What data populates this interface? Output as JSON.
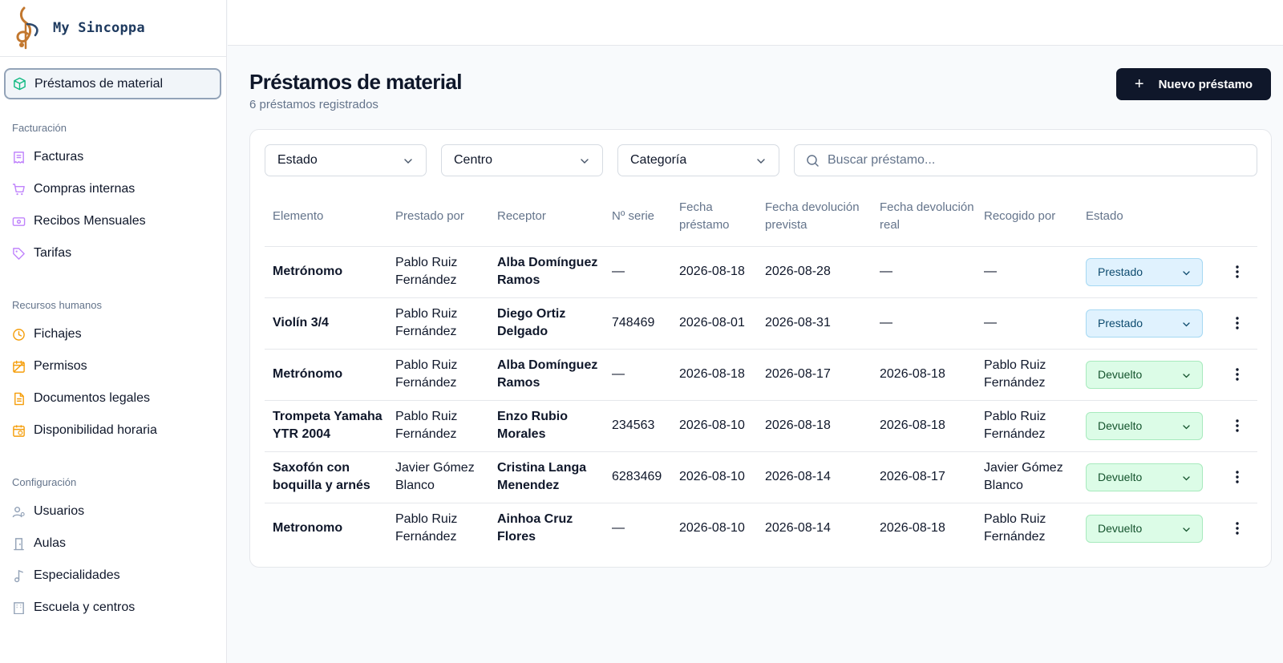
{
  "app": {
    "name": "My Sincoppa"
  },
  "colors": {
    "primary": "#0f172a",
    "prestado_bg": "#e0f2fe",
    "devuelto_bg": "#dcfce7",
    "muted": "#64748b"
  },
  "sidebar": {
    "active": {
      "label": "Préstamos de material",
      "icon": "box-icon"
    },
    "sections": [
      {
        "title": "Facturación",
        "items": [
          {
            "label": "Facturas",
            "icon": "invoice-icon"
          },
          {
            "label": "Compras internas",
            "icon": "cart-icon"
          },
          {
            "label": "Recibos Mensuales",
            "icon": "banknote-icon"
          },
          {
            "label": "Tarifas",
            "icon": "tag-icon"
          }
        ]
      },
      {
        "title": "Recursos humanos",
        "items": [
          {
            "label": "Fichajes",
            "icon": "clock-icon"
          },
          {
            "label": "Permisos",
            "icon": "calendar-off-icon"
          },
          {
            "label": "Documentos legales",
            "icon": "document-icon"
          },
          {
            "label": "Disponibilidad horaria",
            "icon": "calendar-clock-icon"
          }
        ]
      },
      {
        "title": "Configuración",
        "items": [
          {
            "label": "Usuarios",
            "icon": "users-icon"
          },
          {
            "label": "Aulas",
            "icon": "door-icon"
          },
          {
            "label": "Especialidades",
            "icon": "music-note-icon"
          },
          {
            "label": "Escuela y centros",
            "icon": "building-icon"
          }
        ]
      }
    ]
  },
  "page": {
    "title": "Préstamos de material",
    "subtitle": "6 préstamos registrados",
    "new_button": "Nuevo préstamo"
  },
  "filters": {
    "estado": "Estado",
    "centro": "Centro",
    "categoria": "Categoría",
    "search_placeholder": "Buscar préstamo..."
  },
  "table": {
    "headers": [
      "Elemento",
      "Prestado por",
      "Receptor",
      "Nº serie",
      "Fecha préstamo",
      "Fecha devolución prevista",
      "Fecha devolución real",
      "Recogido por",
      "Estado"
    ],
    "rows": [
      {
        "elemento": "Metrónomo",
        "prestado_por": "Pablo Ruiz Fernández",
        "receptor": "Alba Domínguez Ramos",
        "serie": "—",
        "fecha_prestamo": "2026-08-18",
        "prevista": "2026-08-28",
        "real": "—",
        "recogido": "—",
        "estado": "Prestado"
      },
      {
        "elemento": "Violín 3/4",
        "prestado_por": "Pablo Ruiz Fernández",
        "receptor": "Diego Ortiz Delgado",
        "serie": "748469",
        "fecha_prestamo": "2026-08-01",
        "prevista": "2026-08-31",
        "real": "—",
        "recogido": "—",
        "estado": "Prestado"
      },
      {
        "elemento": "Metrónomo",
        "prestado_por": "Pablo Ruiz Fernández",
        "receptor": "Alba Domínguez Ramos",
        "serie": "—",
        "fecha_prestamo": "2026-08-18",
        "prevista": "2026-08-17",
        "real": "2026-08-18",
        "recogido": "Pablo Ruiz Fernández",
        "estado": "Devuelto"
      },
      {
        "elemento": "Trompeta Yamaha YTR 2004",
        "prestado_por": "Pablo Ruiz Fernández",
        "receptor": "Enzo Rubio Morales",
        "serie": "234563",
        "fecha_prestamo": "2026-08-10",
        "prevista": "2026-08-18",
        "real": "2026-08-18",
        "recogido": "Pablo Ruiz Fernández",
        "estado": "Devuelto"
      },
      {
        "elemento": "Saxofón con boquilla y arnés",
        "prestado_por": "Javier Gómez Blanco",
        "receptor": "Cristina Langa Menendez",
        "serie": "6283469",
        "fecha_prestamo": "2026-08-10",
        "prevista": "2026-08-14",
        "real": "2026-08-17",
        "recogido": "Javier Gómez Blanco",
        "estado": "Devuelto"
      },
      {
        "elemento": "Metronomo",
        "prestado_por": "Pablo Ruiz Fernández",
        "receptor": "Ainhoa Cruz Flores",
        "serie": "—",
        "fecha_prestamo": "2026-08-10",
        "prevista": "2026-08-14",
        "real": "2026-08-18",
        "recogido": "Pablo Ruiz Fernández",
        "estado": "Devuelto"
      }
    ]
  }
}
